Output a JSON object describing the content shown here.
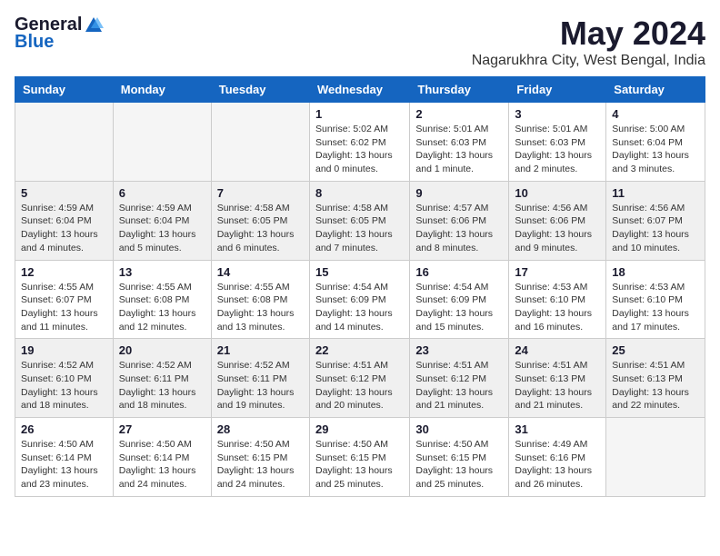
{
  "logo": {
    "general": "General",
    "blue": "Blue"
  },
  "title": "May 2024",
  "location": "Nagarukhra City, West Bengal, India",
  "days_of_week": [
    "Sunday",
    "Monday",
    "Tuesday",
    "Wednesday",
    "Thursday",
    "Friday",
    "Saturday"
  ],
  "weeks": [
    [
      {
        "day": "",
        "empty": true
      },
      {
        "day": "",
        "empty": true
      },
      {
        "day": "",
        "empty": true
      },
      {
        "day": "1",
        "sunrise": "5:02 AM",
        "sunset": "6:02 PM",
        "daylight": "13 hours and 0 minutes."
      },
      {
        "day": "2",
        "sunrise": "5:01 AM",
        "sunset": "6:03 PM",
        "daylight": "13 hours and 1 minute."
      },
      {
        "day": "3",
        "sunrise": "5:01 AM",
        "sunset": "6:03 PM",
        "daylight": "13 hours and 2 minutes."
      },
      {
        "day": "4",
        "sunrise": "5:00 AM",
        "sunset": "6:04 PM",
        "daylight": "13 hours and 3 minutes."
      }
    ],
    [
      {
        "day": "5",
        "sunrise": "4:59 AM",
        "sunset": "6:04 PM",
        "daylight": "13 hours and 4 minutes."
      },
      {
        "day": "6",
        "sunrise": "4:59 AM",
        "sunset": "6:04 PM",
        "daylight": "13 hours and 5 minutes."
      },
      {
        "day": "7",
        "sunrise": "4:58 AM",
        "sunset": "6:05 PM",
        "daylight": "13 hours and 6 minutes."
      },
      {
        "day": "8",
        "sunrise": "4:58 AM",
        "sunset": "6:05 PM",
        "daylight": "13 hours and 7 minutes."
      },
      {
        "day": "9",
        "sunrise": "4:57 AM",
        "sunset": "6:06 PM",
        "daylight": "13 hours and 8 minutes."
      },
      {
        "day": "10",
        "sunrise": "4:56 AM",
        "sunset": "6:06 PM",
        "daylight": "13 hours and 9 minutes."
      },
      {
        "day": "11",
        "sunrise": "4:56 AM",
        "sunset": "6:07 PM",
        "daylight": "13 hours and 10 minutes."
      }
    ],
    [
      {
        "day": "12",
        "sunrise": "4:55 AM",
        "sunset": "6:07 PM",
        "daylight": "13 hours and 11 minutes."
      },
      {
        "day": "13",
        "sunrise": "4:55 AM",
        "sunset": "6:08 PM",
        "daylight": "13 hours and 12 minutes."
      },
      {
        "day": "14",
        "sunrise": "4:55 AM",
        "sunset": "6:08 PM",
        "daylight": "13 hours and 13 minutes."
      },
      {
        "day": "15",
        "sunrise": "4:54 AM",
        "sunset": "6:09 PM",
        "daylight": "13 hours and 14 minutes."
      },
      {
        "day": "16",
        "sunrise": "4:54 AM",
        "sunset": "6:09 PM",
        "daylight": "13 hours and 15 minutes."
      },
      {
        "day": "17",
        "sunrise": "4:53 AM",
        "sunset": "6:10 PM",
        "daylight": "13 hours and 16 minutes."
      },
      {
        "day": "18",
        "sunrise": "4:53 AM",
        "sunset": "6:10 PM",
        "daylight": "13 hours and 17 minutes."
      }
    ],
    [
      {
        "day": "19",
        "sunrise": "4:52 AM",
        "sunset": "6:10 PM",
        "daylight": "13 hours and 18 minutes."
      },
      {
        "day": "20",
        "sunrise": "4:52 AM",
        "sunset": "6:11 PM",
        "daylight": "13 hours and 18 minutes."
      },
      {
        "day": "21",
        "sunrise": "4:52 AM",
        "sunset": "6:11 PM",
        "daylight": "13 hours and 19 minutes."
      },
      {
        "day": "22",
        "sunrise": "4:51 AM",
        "sunset": "6:12 PM",
        "daylight": "13 hours and 20 minutes."
      },
      {
        "day": "23",
        "sunrise": "4:51 AM",
        "sunset": "6:12 PM",
        "daylight": "13 hours and 21 minutes."
      },
      {
        "day": "24",
        "sunrise": "4:51 AM",
        "sunset": "6:13 PM",
        "daylight": "13 hours and 21 minutes."
      },
      {
        "day": "25",
        "sunrise": "4:51 AM",
        "sunset": "6:13 PM",
        "daylight": "13 hours and 22 minutes."
      }
    ],
    [
      {
        "day": "26",
        "sunrise": "4:50 AM",
        "sunset": "6:14 PM",
        "daylight": "13 hours and 23 minutes."
      },
      {
        "day": "27",
        "sunrise": "4:50 AM",
        "sunset": "6:14 PM",
        "daylight": "13 hours and 24 minutes."
      },
      {
        "day": "28",
        "sunrise": "4:50 AM",
        "sunset": "6:15 PM",
        "daylight": "13 hours and 24 minutes."
      },
      {
        "day": "29",
        "sunrise": "4:50 AM",
        "sunset": "6:15 PM",
        "daylight": "13 hours and 25 minutes."
      },
      {
        "day": "30",
        "sunrise": "4:50 AM",
        "sunset": "6:15 PM",
        "daylight": "13 hours and 25 minutes."
      },
      {
        "day": "31",
        "sunrise": "4:49 AM",
        "sunset": "6:16 PM",
        "daylight": "13 hours and 26 minutes."
      },
      {
        "day": "",
        "empty": true
      }
    ]
  ],
  "labels": {
    "sunrise": "Sunrise:",
    "sunset": "Sunset:",
    "daylight": "Daylight:"
  }
}
